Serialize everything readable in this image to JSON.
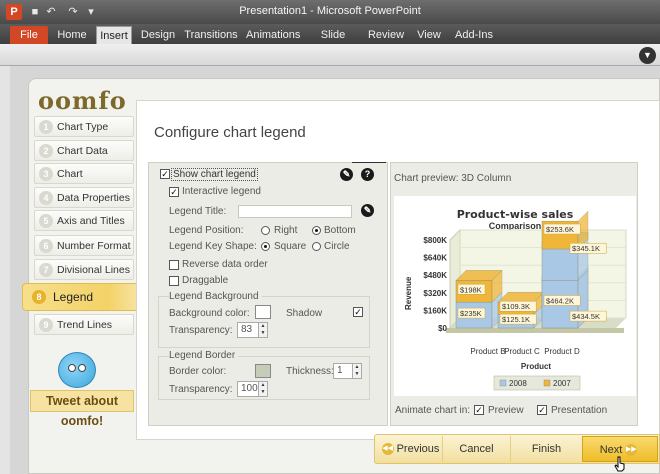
{
  "window": {
    "title": "Presentation1 - Microsoft PowerPoint",
    "app_icon": "P",
    "quick_access": [
      "save-icon",
      "undo-icon",
      "redo-icon",
      "customize-icon"
    ]
  },
  "ribbon": {
    "tabs": [
      "File",
      "Home",
      "Insert",
      "Design",
      "Transitions",
      "Animations",
      "Slide Show",
      "Review",
      "View",
      "Add-Ins"
    ],
    "active_tab": "Insert",
    "file_color": "#d24726"
  },
  "wizard": {
    "logo": "oomfo",
    "title": "Configure chart legend",
    "steps": [
      {
        "num": "1",
        "label": "Chart Type"
      },
      {
        "num": "2",
        "label": "Chart Data"
      },
      {
        "num": "3",
        "label": "Chart Cosmetics"
      },
      {
        "num": "4",
        "label": "Data Properties"
      },
      {
        "num": "5",
        "label": "Axis and Titles"
      },
      {
        "num": "6",
        "label": "Number Format"
      },
      {
        "num": "7",
        "label": "Divisional Lines"
      },
      {
        "num": "8",
        "label": "Legend"
      },
      {
        "num": "9",
        "label": "Trend Lines"
      }
    ],
    "active_step": "Legend",
    "tweet": "Tweet about oomfo!"
  },
  "legend": {
    "show_chart_legend": {
      "label": "Show chart legend",
      "checked": true
    },
    "interactive_legend": {
      "label": "Interactive legend",
      "checked": true
    },
    "legend_title_label": "Legend Title:",
    "legend_title_value": "",
    "position_label": "Legend Position:",
    "position_options": [
      "Right",
      "Bottom"
    ],
    "position_selected": "Bottom",
    "key_shape_label": "Legend Key Shape:",
    "key_shape_options": [
      "Square",
      "Circle"
    ],
    "key_shape_selected": "Square",
    "reverse_data_order": {
      "label": "Reverse data order",
      "checked": false
    },
    "draggable": {
      "label": "Draggable",
      "checked": false
    },
    "background": {
      "group_label": "Legend Background",
      "color_label": "Background color:",
      "color": "#ffffff",
      "shadow_label": "Shadow",
      "shadow_checked": true,
      "transparency_label": "Transparency:",
      "transparency": "83"
    },
    "border": {
      "group_label": "Legend Border",
      "color_label": "Border color:",
      "color": "#c5ccb8",
      "thickness_label": "Thickness:",
      "thickness": "1",
      "transparency_label": "Transparency:",
      "transparency": "100"
    }
  },
  "preview": {
    "label": "Chart preview: 3D Column",
    "animate_label": "Animate chart in:",
    "animate_preview": {
      "label": "Preview",
      "checked": true
    },
    "animate_presentation": {
      "label": "Presentation",
      "checked": true
    }
  },
  "chart_data": {
    "type": "bar",
    "stacked": true,
    "three_d": true,
    "title": "Product-wise sales",
    "subtitle": "Comparison",
    "xlabel": "Product",
    "ylabel": "Revenue",
    "categories": [
      "Product B",
      "Product C",
      "Product D"
    ],
    "series": [
      {
        "name": "2008",
        "values": [
          235,
          125.1,
          464.2
        ],
        "labels": [
          "$235K",
          "$125.1K",
          "$464.2K"
        ],
        "color": "#a9c8e6"
      },
      {
        "name": "2007",
        "values": [
          198,
          109.3,
          253.6
        ],
        "labels": [
          "$198K",
          "$109.3K",
          "$253.6K"
        ],
        "color": "#efb63a"
      }
    ],
    "extra_top": {
      "values": [
        null,
        null,
        345.1
      ],
      "labels": [
        "",
        "",
        "$345.1K"
      ]
    },
    "extra_mid": {
      "values": [
        null,
        null,
        434.5
      ],
      "labels": [
        "",
        "",
        "$434.5K"
      ]
    },
    "yticks": [
      "$0",
      "$160K",
      "$320K",
      "$480K",
      "$640K",
      "$800K"
    ],
    "ylim": [
      0,
      800
    ],
    "legend_position": "bottom"
  },
  "buttons": {
    "previous": "Previous",
    "cancel": "Cancel",
    "finish": "Finish",
    "next": "Next"
  }
}
